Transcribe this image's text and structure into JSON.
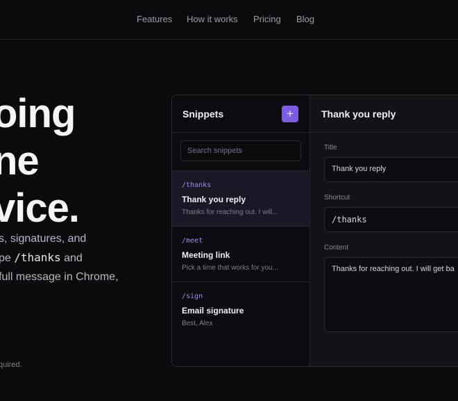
{
  "nav": {
    "items": [
      "Features",
      "How it works",
      "Pricing",
      "Blog"
    ]
  },
  "hero": {
    "title_lines": [
      "oing",
      "ne",
      "vice."
    ],
    "sub_line1": "s, signatures, and",
    "sub_line2_pre": "pe ",
    "sub_line2_code": "/thanks",
    "sub_line2_post": " and",
    "sub_line3": "full message in Chrome,",
    "footnote": "quired."
  },
  "app": {
    "sidebar_title": "Snippets",
    "add_icon": "plus-icon",
    "add_label": "+",
    "search_placeholder": "Search snippets",
    "snippets": [
      {
        "shortcut": "/thanks",
        "title": "Thank you reply",
        "preview": "Thanks for reaching out. I will..."
      },
      {
        "shortcut": "/meet",
        "title": "Meeting link",
        "preview": "Pick a time that works for you..."
      },
      {
        "shortcut": "/sign",
        "title": "Email signature",
        "preview": "Best, Alex"
      }
    ],
    "editor": {
      "header": "Thank you reply",
      "title_label": "Title",
      "title_value": "Thank you reply",
      "shortcut_label": "Shortcut",
      "shortcut_value": "/thanks",
      "content_label": "Content",
      "content_value": "Thanks for reaching out. I will get ba"
    }
  },
  "colors": {
    "accent": "#7c5ce0",
    "shortcut": "#a58bf0",
    "background": "#0b0b0e"
  }
}
